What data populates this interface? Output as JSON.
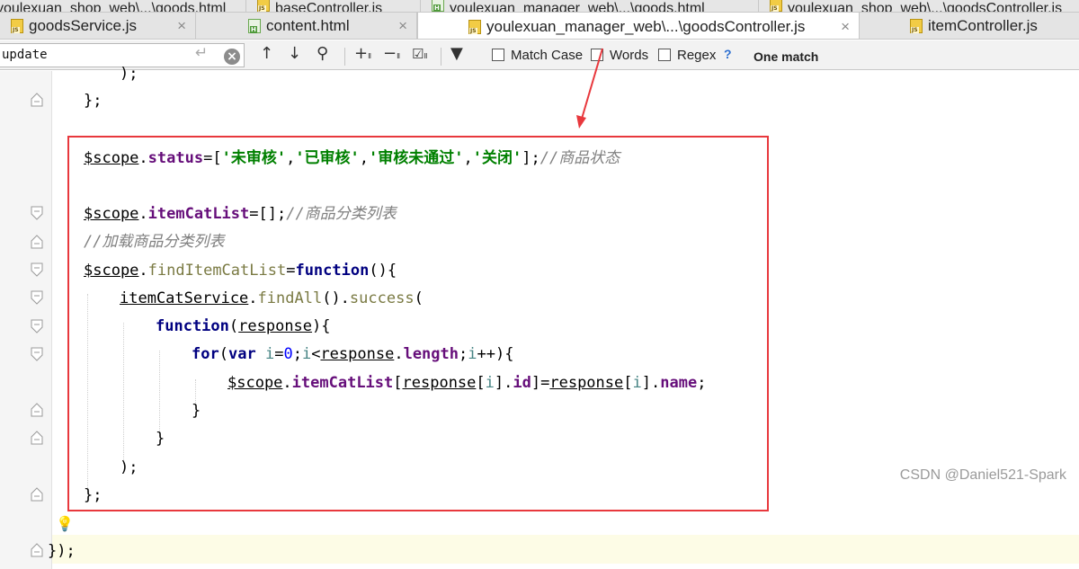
{
  "tabs_row1": [
    {
      "label": "youlexuan_shop_web\\...\\goods.html",
      "icon": "js-file-icon"
    },
    {
      "label": "baseController.js",
      "icon": "js-file-icon"
    },
    {
      "label": "youlexuan_manager_web\\...\\goods.html",
      "icon": "html-file-icon"
    },
    {
      "label": "youlexuan_shop_web\\...\\goodsController.js",
      "icon": "js-file-icon"
    }
  ],
  "tabs_row2": [
    {
      "label": "goodsService.js",
      "icon": "js-file-icon",
      "close": "×"
    },
    {
      "label": "content.html",
      "icon": "html-file-icon",
      "close": "×"
    },
    {
      "label": "youlexuan_manager_web\\...\\goodsController.js",
      "icon": "js-file-icon",
      "close": "×",
      "active": true
    },
    {
      "label": "itemController.js",
      "icon": "js-file-icon"
    }
  ],
  "search": {
    "value": "update",
    "options": {
      "match_case": "Match Case",
      "words": "Words",
      "regex": "Regex"
    },
    "help": "?",
    "result": "One match"
  },
  "code_lines": {
    "l0": ");",
    "l1": "};",
    "status_scope": "$scope",
    "status_prop": "status",
    "status_s1": "'未审核'",
    "status_s2": "'已审核'",
    "status_s3": "'审核未通过'",
    "status_s4": "'关闭'",
    "status_comment": "//商品状态",
    "icl_scope": "$scope",
    "icl_prop": "itemCatList",
    "icl_comment": "//商品分类列表",
    "load_comment": "//加载商品分类列表",
    "fn_scope": "$scope",
    "fn_name": "findItemCatList",
    "kw_function": "function",
    "svc": "itemCatService",
    "svc_findall": "findAll",
    "svc_success": "success",
    "kw_function2": "function",
    "param": "response",
    "kw_for": "for",
    "kw_var": "var",
    "loop_i": "i",
    "loop_zero": "0",
    "loop_i2": "i",
    "loop_resp": "response",
    "loop_length": "length",
    "loop_i3": "i",
    "a_scope": "$scope",
    "a_list": "itemCatList",
    "a_resp": "response",
    "a_i": "i",
    "a_id": "id",
    "a_resp2": "response",
    "a_i2": "i",
    "a_name": "name",
    "close_brace1": "}",
    "close_brace2": "}",
    "close_paren": ");",
    "close_semi": "};",
    "last": "});"
  },
  "watermark": "CSDN @Daniel521-Spark",
  "colors": {
    "highlight_box": "#e8383d",
    "keyword": "#000080",
    "string": "#008000",
    "field": "#660e7a",
    "comment": "#808080"
  }
}
